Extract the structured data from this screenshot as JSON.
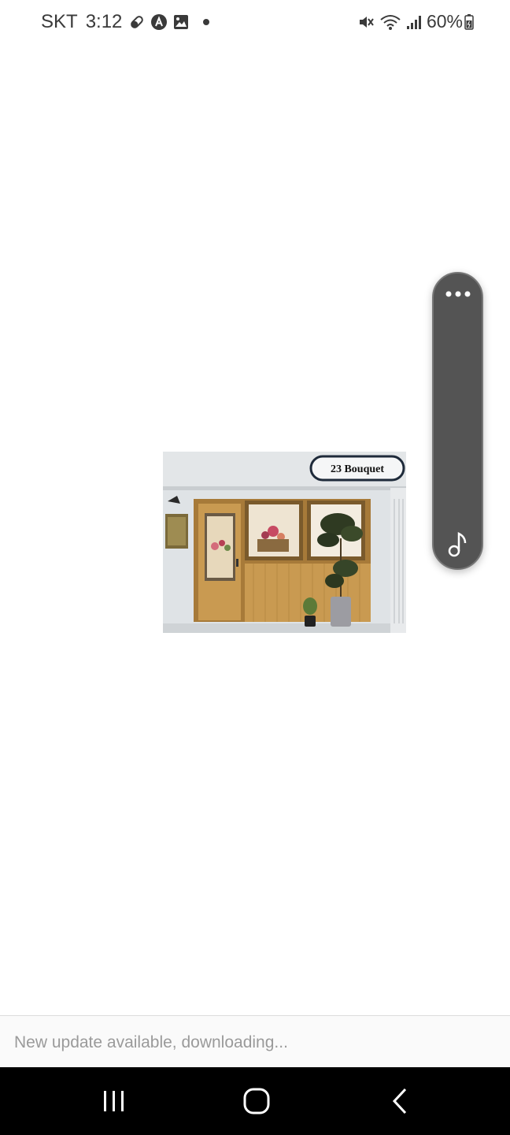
{
  "status_bar": {
    "carrier": "SKT",
    "time": "3:12",
    "battery": "60%",
    "icons_left": [
      "pill-icon",
      "app-a-icon",
      "gallery-icon",
      "dot-icon"
    ],
    "icons_right": [
      "mute-icon",
      "wifi-icon",
      "signal-icon",
      "battery-icon"
    ]
  },
  "content": {
    "photo": {
      "sign_text": "23 Bouquet"
    }
  },
  "side_panel": {
    "icons": [
      "more-dots-icon",
      "music-note-icon"
    ]
  },
  "update_banner": {
    "text": "New update available, downloading..."
  },
  "nav_bar": {
    "icons": [
      "recent-apps-icon",
      "home-icon",
      "back-icon"
    ]
  },
  "colors": {
    "panel": "#545454",
    "nav_bg": "#000000",
    "banner_text": "#9a9a9a"
  }
}
